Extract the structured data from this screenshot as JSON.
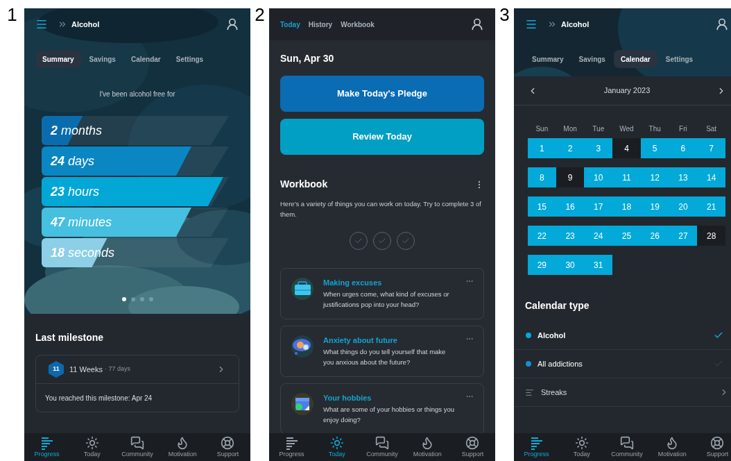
{
  "screens": [
    {
      "kind": "summary",
      "number": "1",
      "header": {
        "title": "Alcohol"
      },
      "tabs": [
        {
          "label": "Summary",
          "selected": true
        },
        {
          "label": "Savings",
          "selected": false
        },
        {
          "label": "Calendar",
          "selected": false
        },
        {
          "label": "Settings",
          "selected": false
        }
      ],
      "intro": "I've been alcohol free for",
      "durations": [
        {
          "text": "**2** months",
          "level": 0.22,
          "color": "#0b6cad"
        },
        {
          "text": "**24** days",
          "level": 0.8,
          "color": "#0a86c3"
        },
        {
          "text": "**23** hours",
          "level": 0.97,
          "color": "#02a7d6"
        },
        {
          "text": "**47** minutes",
          "level": 0.8,
          "color": "#46bfe0"
        },
        {
          "text": "**18** seconds",
          "level": 0.35,
          "color": "#8ccfe6"
        }
      ],
      "page_dots": [
        {
          "selected": true
        },
        {
          "selected": false
        },
        {
          "selected": false
        },
        {
          "selected": false
        }
      ],
      "milestone": {
        "heading": "Last milestone",
        "badge": "11",
        "name": "11 Weeks",
        "detail": "· 77 days",
        "note": "You reached this milestone: Apr 24"
      },
      "nav": [
        {
          "kind": "progress",
          "label": "Progress",
          "selected": true
        },
        {
          "kind": "today",
          "label": "Today",
          "selected": false
        },
        {
          "kind": "community",
          "label": "Community",
          "selected": false
        },
        {
          "kind": "motivation",
          "label": "Motivation",
          "selected": false
        },
        {
          "kind": "support",
          "label": "Support",
          "selected": false
        }
      ]
    },
    {
      "kind": "today",
      "number": "2",
      "tabs": [
        {
          "label": "Today",
          "selected": true
        },
        {
          "label": "History",
          "selected": false
        },
        {
          "label": "Workbook",
          "selected": false
        }
      ],
      "date": "Sun, Apr 30",
      "buttons": [
        {
          "label": "Make Today's Pledge",
          "color": "#0a6cb3"
        },
        {
          "label": "Review Today",
          "color": "#029fc4"
        }
      ],
      "workbook": {
        "title": "Workbook",
        "description": "Here's a variety of things you can work on today. Try to complete 3 of them.",
        "checks": [
          {
            "checked": false
          },
          {
            "checked": false
          },
          {
            "checked": false
          }
        ],
        "cards": [
          {
            "kind": "briefcase",
            "title": "Making excuses",
            "description": "When urges come, what kind of excuses or justifications pop into your head?"
          },
          {
            "kind": "thought-cloud",
            "title": "Anxiety about future",
            "description": "What things do you tell yourself that make you anxious about the future?"
          },
          {
            "kind": "calendar",
            "title": "Your hobbies",
            "description": "What are some of your hobbies or things you enjoy doing?"
          }
        ]
      },
      "nav": [
        {
          "kind": "progress",
          "label": "Progress",
          "selected": false
        },
        {
          "kind": "today",
          "label": "Today",
          "selected": true
        },
        {
          "kind": "community",
          "label": "Community",
          "selected": false
        },
        {
          "kind": "motivation",
          "label": "Motivation",
          "selected": false
        },
        {
          "kind": "support",
          "label": "Support",
          "selected": false
        }
      ]
    },
    {
      "kind": "calendar",
      "number": "3",
      "header": {
        "title": "Alcohol"
      },
      "tabs": [
        {
          "label": "Summary",
          "selected": false
        },
        {
          "label": "Savings",
          "selected": false
        },
        {
          "label": "Calendar",
          "selected": true
        },
        {
          "label": "Settings",
          "selected": false
        }
      ],
      "month": "January 2023",
      "weekdays": [
        "Sun",
        "Mon",
        "Tue",
        "Wed",
        "Thu",
        "Fri",
        "Sat"
      ],
      "weeks": [
        [
          {
            "day": "1",
            "free": true
          },
          {
            "day": "2",
            "free": true
          },
          {
            "day": "3",
            "free": true
          },
          {
            "day": "4",
            "free": false
          },
          {
            "day": "5",
            "free": true
          },
          {
            "day": "6",
            "free": true
          },
          {
            "day": "7",
            "free": true
          }
        ],
        [
          {
            "day": "8",
            "free": true
          },
          {
            "day": "9",
            "free": false
          },
          {
            "day": "10",
            "free": true
          },
          {
            "day": "11",
            "free": true
          },
          {
            "day": "12",
            "free": true
          },
          {
            "day": "13",
            "free": true
          },
          {
            "day": "14",
            "free": true
          }
        ],
        [
          {
            "day": "15",
            "free": true
          },
          {
            "day": "16",
            "free": true
          },
          {
            "day": "17",
            "free": true
          },
          {
            "day": "18",
            "free": true
          },
          {
            "day": "19",
            "free": true
          },
          {
            "day": "20",
            "free": true
          },
          {
            "day": "21",
            "free": true
          }
        ],
        [
          {
            "day": "22",
            "free": true
          },
          {
            "day": "23",
            "free": true
          },
          {
            "day": "24",
            "free": true
          },
          {
            "day": "25",
            "free": true
          },
          {
            "day": "26",
            "free": true
          },
          {
            "day": "27",
            "free": true
          },
          {
            "day": "28",
            "free": false
          }
        ],
        [
          {
            "day": "29",
            "free": true
          },
          {
            "day": "30",
            "free": true
          },
          {
            "day": "31",
            "free": true
          }
        ]
      ],
      "calendar_type": {
        "title": "Calendar type",
        "items": [
          {
            "kind": "type",
            "label": "Alcohol",
            "color": "#03a9dc",
            "selected": true
          },
          {
            "kind": "type",
            "label": "All addictions",
            "color": "#138fd2",
            "selected": false
          },
          {
            "kind": "link",
            "label": "Streaks"
          }
        ]
      },
      "nav": [
        {
          "kind": "progress",
          "label": "Progress",
          "selected": true
        },
        {
          "kind": "today",
          "label": "Today",
          "selected": false
        },
        {
          "kind": "community",
          "label": "Community",
          "selected": false
        },
        {
          "kind": "motivation",
          "label": "Motivation",
          "selected": false
        },
        {
          "kind": "support",
          "label": "Support",
          "selected": false
        }
      ]
    }
  ]
}
